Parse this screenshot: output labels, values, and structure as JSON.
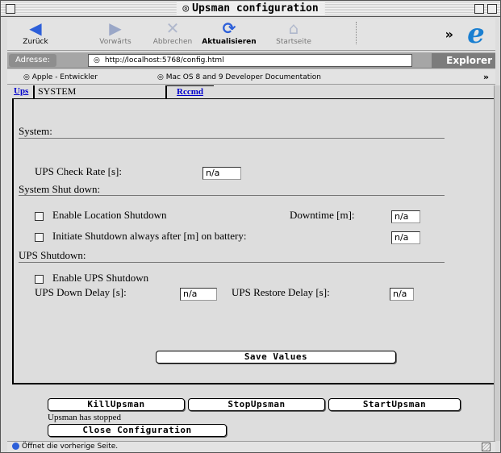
{
  "window": {
    "title": "Upsman configuration"
  },
  "toolbar": {
    "back_label": "Zurück",
    "forward_label": "Vorwärts",
    "stop_label": "Abbrechen",
    "refresh_label": "Aktualisieren",
    "home_label": "Startseite",
    "more_label": "»"
  },
  "address": {
    "label": "Adresse:",
    "url": "http://localhost:5768/config.html",
    "explorer_label": "Explorer"
  },
  "favorites": {
    "items": [
      {
        "label": "Apple - Entwickler"
      },
      {
        "label": "Mac OS 8 and 9 Developer Documentation"
      }
    ],
    "more_label": "»"
  },
  "tabs": {
    "ups": "Ups",
    "system": "SYSTEM",
    "rccmd": "Rccmd"
  },
  "system": {
    "heading": "System:",
    "check_rate_label": "UPS Check Rate [s]:",
    "check_rate_value": "n/a"
  },
  "shutdown": {
    "heading": "System Shut down:",
    "location_label": "Enable Location Shutdown",
    "downtime_label": "Downtime [m]:",
    "downtime_value": "n/a",
    "initiate_label": "Initiate Shutdown always after [m] on battery:",
    "initiate_value": "n/a"
  },
  "ups_shutdown": {
    "heading": "UPS Shutdown:",
    "enable_label": "Enable UPS Shutdown",
    "down_delay_label": "UPS Down Delay [s]:",
    "down_delay_value": "n/a",
    "restore_delay_label": "UPS Restore Delay [s]:",
    "restore_delay_value": "n/a"
  },
  "actions": {
    "save_label": "Save Values",
    "kill_label": "KillUpsman",
    "stop_label": "StopUpsman",
    "start_label": "StartUpsman",
    "status_text": "Upsman has stopped",
    "close_label": "Close Configuration"
  },
  "statusbar": {
    "text": "Öffnet die vorherige Seite."
  }
}
